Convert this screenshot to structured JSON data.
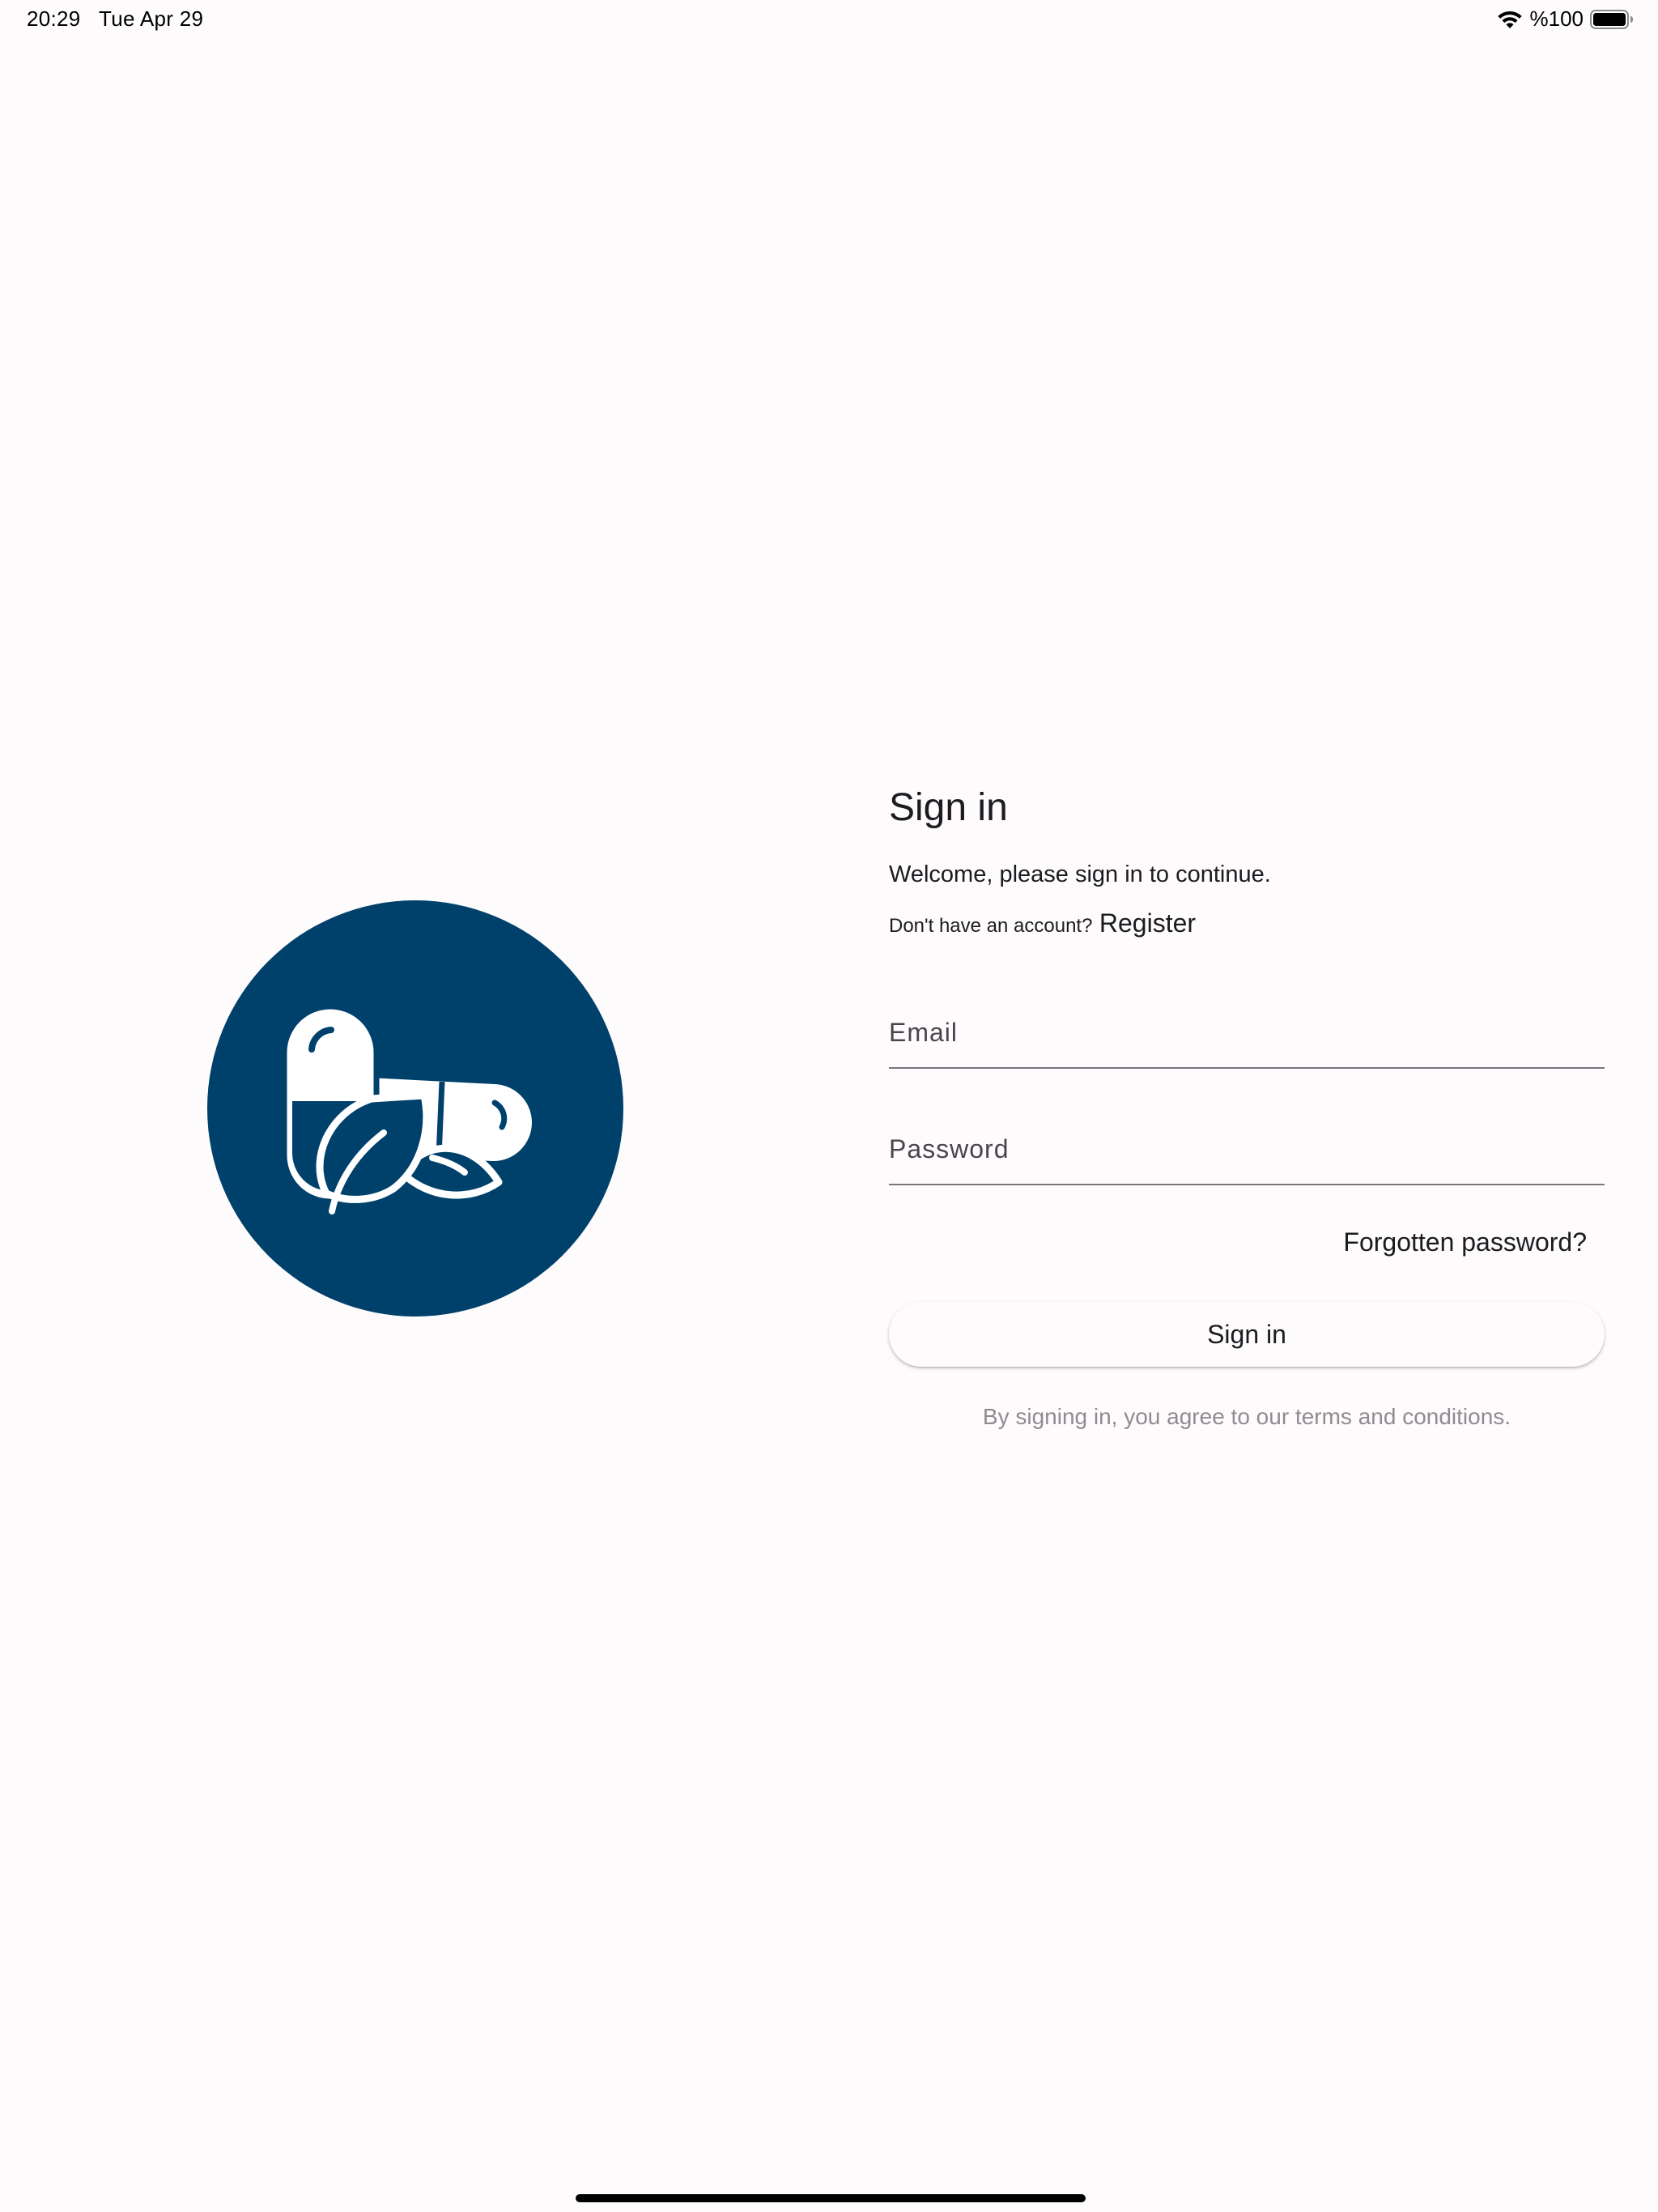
{
  "status_bar": {
    "time": "20:29",
    "date": "Tue Apr 29",
    "battery": "%100",
    "wifi_icon": "wifi-icon",
    "battery_icon": "battery-full-icon"
  },
  "logo": {
    "icon": "pill-leaf-icon",
    "background_color": "#00416b",
    "foreground_color": "#ffffff"
  },
  "form": {
    "title": "Sign in",
    "subtitle": "Welcome, please sign in to continue.",
    "no_account_text": "Don't have an account?",
    "register_label": "Register",
    "email": {
      "placeholder": "Email",
      "value": ""
    },
    "password": {
      "placeholder": "Password",
      "value": ""
    },
    "forgot_password_label": "Forgotten password?",
    "sign_in_label": "Sign in",
    "terms_text": "By signing in, you agree to our terms and conditions."
  },
  "colors": {
    "background": "#fefbfd",
    "brand": "#00416b",
    "text": "#1c1b1f",
    "muted_text": "#8e8b92",
    "underline": "#79747e"
  }
}
